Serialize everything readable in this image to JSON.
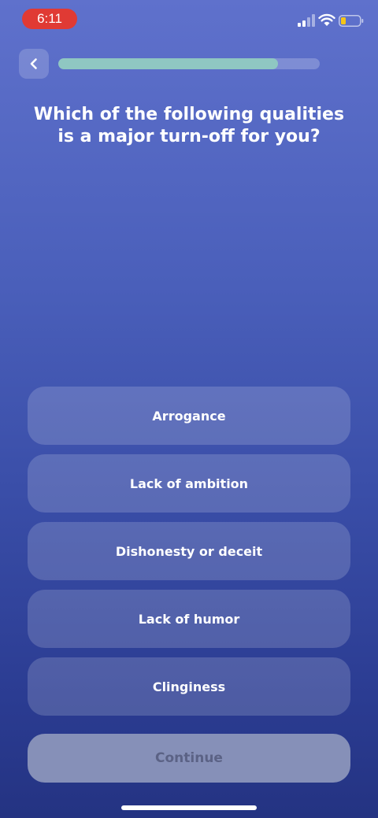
{
  "status_bar": {
    "time": "6:11",
    "icons": [
      "signal-icon",
      "wifi-icon",
      "battery-icon"
    ]
  },
  "header": {
    "back_icon": "chevron-left-icon",
    "progress": 0.84
  },
  "question": "Which of the following qualities is a major turn-off for you?",
  "options": [
    {
      "label": "Arrogance"
    },
    {
      "label": "Lack of ambition"
    },
    {
      "label": "Dishonesty or deceit"
    },
    {
      "label": "Lack of humor"
    },
    {
      "label": "Clinginess"
    }
  ],
  "continue_label": "Continue",
  "colors": {
    "time_pill": "#e03a34",
    "progress_fill": "#8fc7c2",
    "battery_level": "#f5c518"
  }
}
